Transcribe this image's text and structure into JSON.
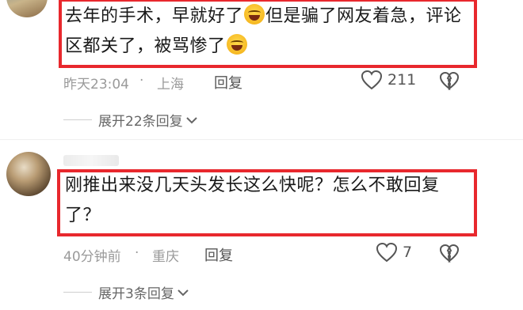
{
  "comments": [
    {
      "text_parts": [
        "去年的手术，早就好了",
        "但是骗了网友着急，评论区都关了，被骂惨了",
        ""
      ],
      "time": "昨天23:04",
      "separator": "·",
      "location": "上海",
      "reply_label": "回复",
      "likes": "211",
      "expand_label": "展开22条回复"
    },
    {
      "text": "刚推出来没几天头发长这么快呢？怎么不敢回复了？",
      "time": "40分钟前",
      "separator": "·",
      "location": "重庆",
      "reply_label": "回复",
      "likes": "7",
      "expand_label": "展开3条回复"
    }
  ],
  "colors": {
    "highlight": "#e8282d",
    "meta": "#9a9a9a",
    "text": "#1a1a1a"
  }
}
